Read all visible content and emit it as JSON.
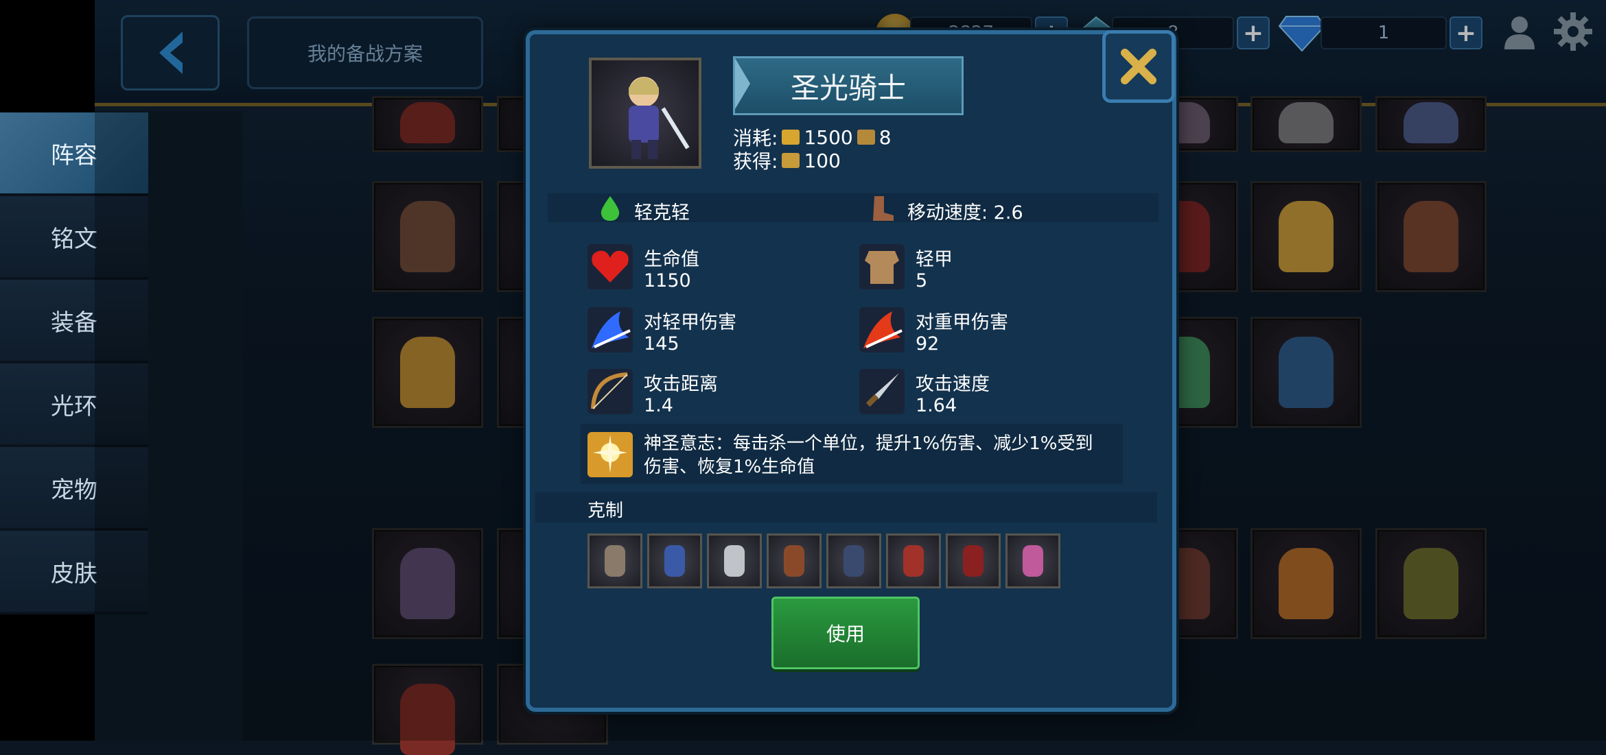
{
  "topbar": {
    "back_label": "",
    "plan_button": "我的备战方案",
    "gold_value": "2827",
    "crystal_value": "8",
    "diamond_value": "1",
    "plus": "+"
  },
  "sidebar": {
    "items": [
      {
        "label": "阵容",
        "active": true
      },
      {
        "label": "铭文",
        "active": false
      },
      {
        "label": "装备",
        "active": false
      },
      {
        "label": "光环",
        "active": false
      },
      {
        "label": "宠物",
        "active": false
      },
      {
        "label": "皮肤",
        "active": false
      }
    ]
  },
  "dialog": {
    "unit_name": "圣光骑士",
    "cost_label": "消耗:",
    "cost_gold": "1500",
    "cost_pop": "8",
    "gain_label": "获得:",
    "gain_value": "100",
    "type_label": "轻克轻",
    "move_speed": "移动速度: 2.6",
    "stats": {
      "hp_label": "生命值",
      "hp_value": "1150",
      "armor_label": "轻甲",
      "armor_value": "5",
      "light_dmg_label": "对轻甲伤害",
      "light_dmg_value": "145",
      "heavy_dmg_label": "对重甲伤害",
      "heavy_dmg_value": "92",
      "range_label": "攻击距离",
      "range_value": "1.4",
      "atk_speed_label": "攻击速度",
      "atk_speed_value": "1.64"
    },
    "skill_line1": "神圣意志：每击杀一个单位，提升1%伤害、减少1%受到",
    "skill_line2": "伤害、恢复1%生命值",
    "counter_label": "克制",
    "use_button": "使用"
  },
  "colors": {
    "accent_gold": "#7a6427",
    "dialog_bg": "#13324d",
    "use_green": "#2a9a3f"
  }
}
